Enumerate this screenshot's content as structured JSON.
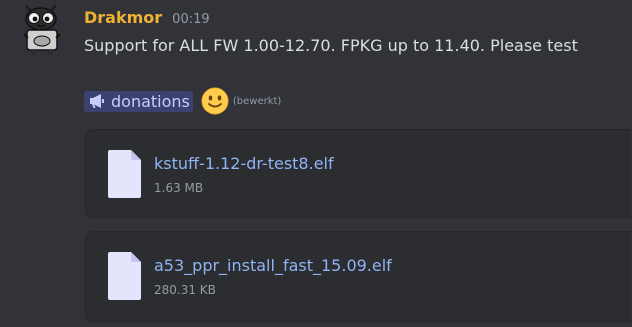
{
  "message": {
    "username": "Drakmor",
    "timestamp": "00:19",
    "text": "Support for ALL FW 1.00-12.70. FPKG up to 11.40. Please test",
    "mention": {
      "label": "donations",
      "icon": "megaphone-icon"
    },
    "emoji": "slightly-smiling-face",
    "edited_label": "(bewerkt)",
    "colors": {
      "username": "#f0b232",
      "link": "#8fb4f4",
      "mention_bg": "#3c4270",
      "background": "#313338"
    }
  },
  "attachments": [
    {
      "name": "kstuff-1.12-dr-test8.elf",
      "size": "1.63 MB",
      "icon": "file-icon"
    },
    {
      "name": "a53_ppr_install_fast_15.09.elf",
      "size": "280.31 KB",
      "icon": "file-icon"
    }
  ]
}
